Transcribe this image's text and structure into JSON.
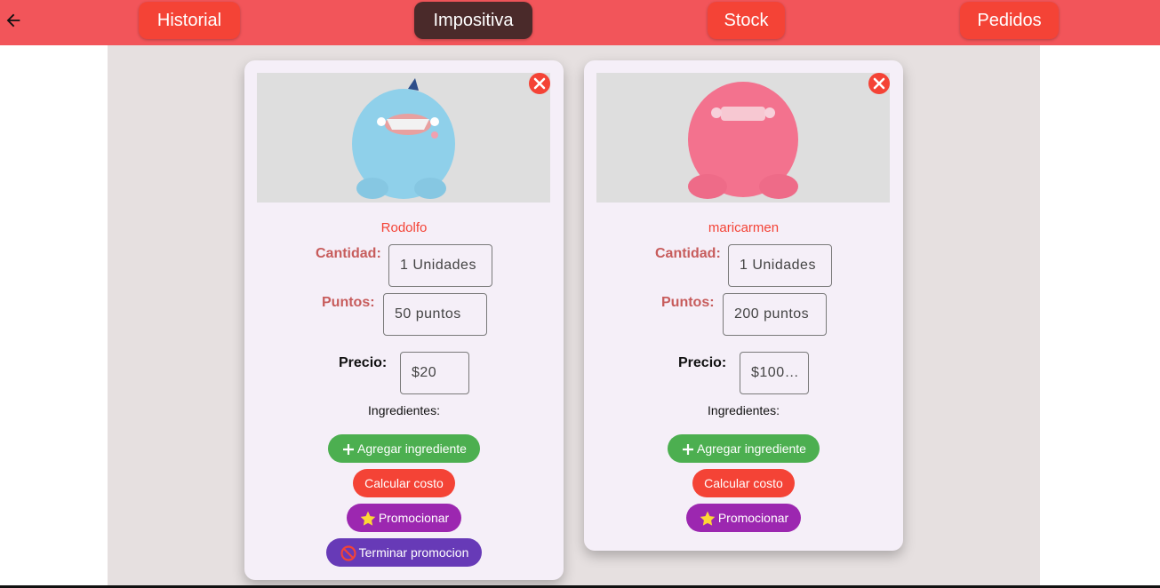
{
  "nav": {
    "tabs": [
      {
        "label": "Historial"
      },
      {
        "label": "Impositiva"
      },
      {
        "label": "Stock"
      },
      {
        "label": "Pedidos"
      }
    ]
  },
  "products": [
    {
      "name": "Rodolfo",
      "cantidad_label": "Cantidad:",
      "cantidad_value": "1 Unidades",
      "puntos_label": "Puntos:",
      "puntos_value": "50 puntos",
      "precio_label": "Precio:",
      "precio_value": "$20",
      "ingredientes_label": "Ingredientes:",
      "add_ingredient": "Agregar ingrediente",
      "calc_cost": "Calcular costo",
      "promote": "Promocionar",
      "end_promo": "Terminar promocion"
    },
    {
      "name": "maricarmen",
      "cantidad_label": "Cantidad:",
      "cantidad_value": "1 Unidades",
      "puntos_label": "Puntos:",
      "puntos_value": "200 puntos",
      "precio_label": "Precio:",
      "precio_value": "$100…",
      "ingredientes_label": "Ingredientes:",
      "add_ingredient": "Agregar ingrediente",
      "calc_cost": "Calcular costo",
      "promote": "Promocionar"
    }
  ],
  "colors": {
    "topbar": "#f2555a",
    "nav_button": "#f44336",
    "nav_active": "#4a2a2a",
    "green": "#4caf50",
    "purple": "#9c27b0",
    "deep_purple": "#673ab7"
  }
}
